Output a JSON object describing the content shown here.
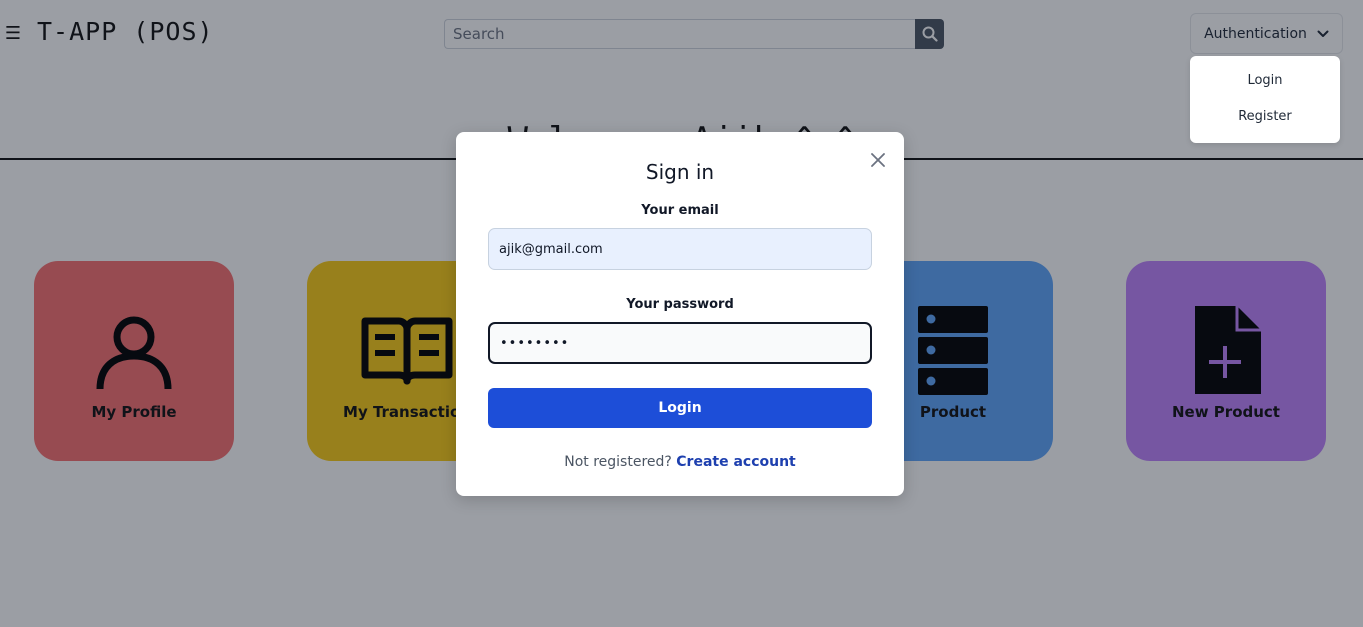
{
  "app": {
    "brand": "T-APP (POS)",
    "menu_icon": "hamburger-icon"
  },
  "search": {
    "placeholder": "Search",
    "value": "",
    "icon": "search-icon"
  },
  "auth": {
    "button_label": "Authentication",
    "chevron_icon": "chevron-down-icon",
    "menu": [
      {
        "label": "Login"
      },
      {
        "label": "Register"
      }
    ]
  },
  "welcome": {
    "heading": "Welcome, Ajik ^_^"
  },
  "cards": [
    {
      "label": "My Profile",
      "icon": "user-icon",
      "color": "#f87171"
    },
    {
      "label": "My Transaction",
      "icon": "book-open-icon",
      "color": "#facc15"
    },
    {
      "label": "Product",
      "icon": "server-icon",
      "color": "#60a5fa"
    },
    {
      "label": "New Product",
      "icon": "file-plus-icon",
      "color": "#c084fc"
    }
  ],
  "modal": {
    "title": "Sign in",
    "close_icon": "close-icon",
    "email_label": "Your email",
    "email_value": "ajik@gmail.com",
    "password_label": "Your password",
    "password_value": "••••••••",
    "login_label": "Login",
    "register_prompt": "Not registered?",
    "register_link": "Create account"
  },
  "colors": {
    "overlay": "#111827",
    "primary": "#1d4ed8",
    "link": "#1e40af"
  }
}
